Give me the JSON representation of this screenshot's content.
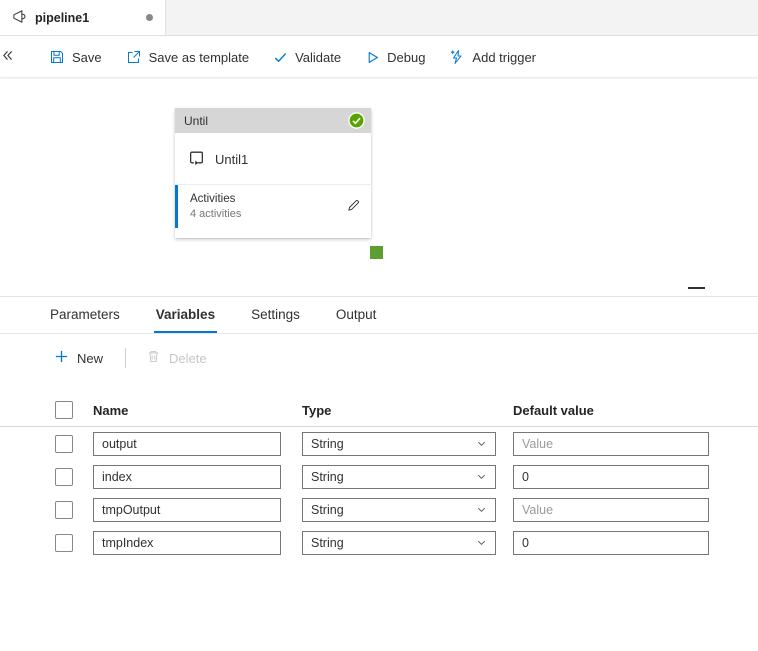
{
  "tab_bar": {
    "active_tab": {
      "title": "pipeline1"
    }
  },
  "toolbar": {
    "save": "Save",
    "save_as_template": "Save as template",
    "validate": "Validate",
    "debug": "Debug",
    "add_trigger": "Add trigger"
  },
  "canvas": {
    "until": {
      "type_label": "Until",
      "name": "Until1",
      "activities_label": "Activities",
      "activities_count": "4 activities"
    }
  },
  "panel": {
    "tabs": [
      "Parameters",
      "Variables",
      "Settings",
      "Output"
    ],
    "active_tab": "Variables",
    "commands": {
      "new": "New",
      "delete": "Delete"
    },
    "table": {
      "headers": [
        "Name",
        "Type",
        "Default value"
      ],
      "rows": [
        {
          "name": "output",
          "type": "String",
          "value": "",
          "placeholder": "Value"
        },
        {
          "name": "index",
          "type": "String",
          "value": "0",
          "placeholder": ""
        },
        {
          "name": "tmpOutput",
          "type": "String",
          "value": "",
          "placeholder": "Value"
        },
        {
          "name": "tmpIndex",
          "type": "String",
          "value": "0",
          "placeholder": ""
        }
      ]
    }
  },
  "colors": {
    "accent_blue": "#0078d4",
    "success_green": "#57a300",
    "connector_green": "#5c9e31",
    "disabled_gray": "#c8c6c4"
  }
}
